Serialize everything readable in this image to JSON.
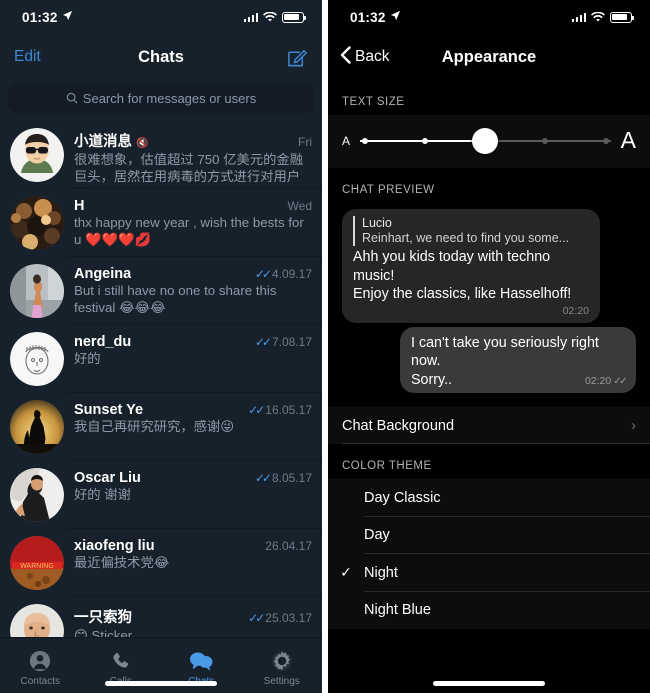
{
  "left": {
    "status": {
      "time": "01:32",
      "location_icon": "location-arrow-icon"
    },
    "nav": {
      "edit": "Edit",
      "title": "Chats",
      "compose_icon": "compose-icon"
    },
    "search": {
      "placeholder": "Search for messages or users",
      "icon": "search-icon"
    },
    "chats": [
      {
        "avatar": "cartoon-sunglasses",
        "name": "小道消息",
        "muted": true,
        "date": "Fri",
        "ticks": false,
        "message": "很难想象，估值超过 750 亿美元的金融巨头，居然在用病毒的方式进行对用户的…"
      },
      {
        "avatar": "crowd-photo",
        "name": "H",
        "muted": false,
        "date": "Wed",
        "ticks": false,
        "message": "thx happy new year , wish the bests for u ❤️❤️❤️💋"
      },
      {
        "avatar": "woman-street",
        "name": "Angeina",
        "muted": false,
        "date": "4.09.17",
        "ticks": true,
        "message": "But i still have no one to share this festival 😂😂😂"
      },
      {
        "avatar": "sketch-face",
        "name": "nerd_du",
        "muted": false,
        "date": "7.08.17",
        "ticks": true,
        "message": "好的"
      },
      {
        "avatar": "sunset-silhouette",
        "name": "Sunset Ye",
        "muted": false,
        "date": "16.05.17",
        "ticks": true,
        "message": "我自己再研究研究，感谢😜"
      },
      {
        "avatar": "man-desk",
        "name": "Oscar Liu",
        "muted": false,
        "date": "8.05.17",
        "ticks": true,
        "message": "好的 谢谢"
      },
      {
        "avatar": "red-poster",
        "name": "xiaofeng liu",
        "muted": false,
        "date": "26.04.17",
        "ticks": false,
        "message": "最近偏技术党😂"
      },
      {
        "avatar": "bald-man",
        "name": "一只索狗",
        "muted": false,
        "date": "25.03.17",
        "ticks": true,
        "message": "😊 Sticker"
      }
    ],
    "tabs": [
      {
        "label": "Contacts",
        "icon": "contacts-icon",
        "active": false
      },
      {
        "label": "Calls",
        "icon": "phone-icon",
        "active": false
      },
      {
        "label": "Chats",
        "icon": "chats-icon",
        "active": true
      },
      {
        "label": "Settings",
        "icon": "gear-icon",
        "active": false
      }
    ],
    "accent_color": "#4b9ae8",
    "background_color": "#17212b"
  },
  "right": {
    "status": {
      "time": "01:32",
      "location_icon": "location-arrow-icon"
    },
    "nav": {
      "back": "Back",
      "title": "Appearance",
      "back_icon": "chevron-left-icon"
    },
    "text_size": {
      "header": "TEXT SIZE",
      "small_label": "A",
      "large_label": "A",
      "steps": 5,
      "value": 3
    },
    "chat_preview": {
      "header": "CHAT PREVIEW",
      "incoming": {
        "reply_name": "Lucio",
        "reply_text": "Reinhart, we need to find you some...",
        "lines": [
          "Ahh you kids today with techno music!",
          "Enjoy the classics, like Hasselhoff!"
        ],
        "time": "02:20"
      },
      "outgoing": {
        "lines": [
          "I can't take you seriously right now.",
          "Sorry.."
        ],
        "time": "02:20",
        "ticks": true
      }
    },
    "chat_background": {
      "label": "Chat Background",
      "chevron": "chevron-right-icon"
    },
    "color_theme": {
      "header": "COLOR THEME",
      "options": [
        {
          "label": "Day Classic",
          "selected": false
        },
        {
          "label": "Day",
          "selected": false
        },
        {
          "label": "Night",
          "selected": true
        },
        {
          "label": "Night Blue",
          "selected": false
        }
      ],
      "check_glyph": "✓"
    },
    "background_color": "#000000"
  }
}
